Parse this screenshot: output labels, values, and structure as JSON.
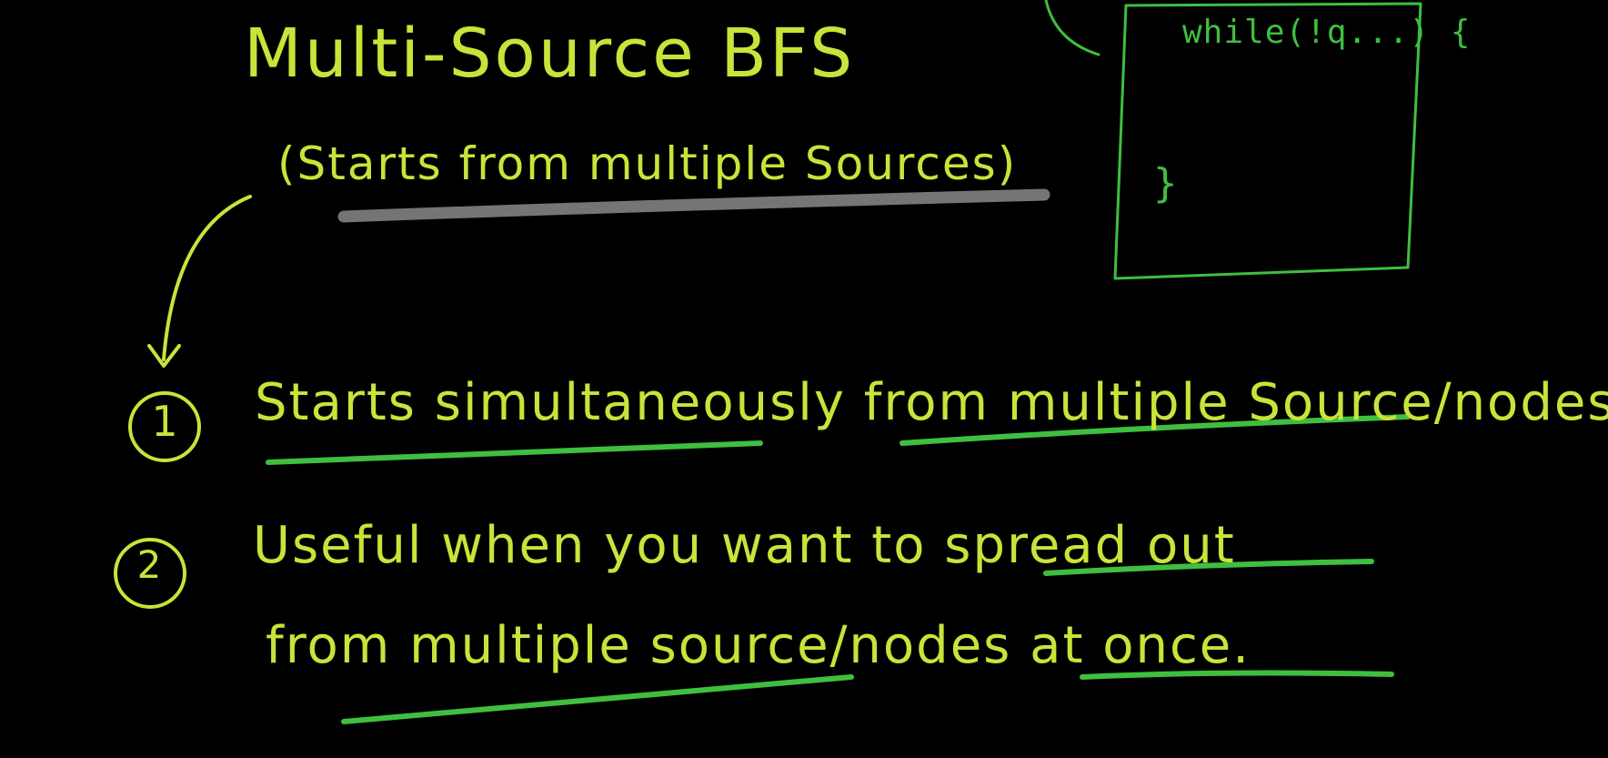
{
  "whiteboard": {
    "title": "Multi-Source BFS",
    "subtitle": "(Starts from multiple Sources)",
    "code_box": {
      "line1": "while(!q...) {",
      "line2": "}"
    },
    "points": [
      {
        "number": "1",
        "text": "Starts simultaneously from multiple Source/nodes."
      },
      {
        "number": "2",
        "text": "Useful when you want to spread out",
        "continuation": "from multiple source/nodes at once."
      }
    ],
    "colors": {
      "background": "#000000",
      "ink_yellow": "#c9e33a",
      "ink_green": "#3fbf3f",
      "highlight_grey": "#8a8a8a"
    }
  }
}
